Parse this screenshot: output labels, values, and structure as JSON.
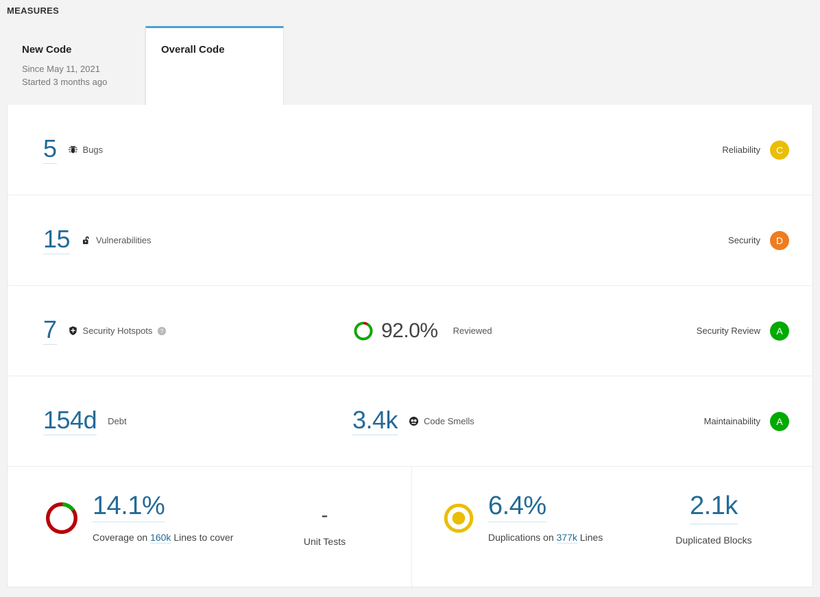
{
  "section": {
    "title": "MEASURES"
  },
  "tabs": [
    {
      "id": "new-code",
      "label": "New Code",
      "sub1": "Since May 11, 2021",
      "sub2": "Started 3 months ago",
      "active": false
    },
    {
      "id": "overall-code",
      "label": "Overall Code",
      "sub1": "",
      "sub2": "",
      "active": true
    }
  ],
  "rows": {
    "bugs": {
      "value": "5",
      "label": "Bugs",
      "icon": "bug-icon",
      "rating_name": "Reliability",
      "rating_letter": "C",
      "rating_color": "#eabe06"
    },
    "vulnerabilities": {
      "value": "15",
      "label": "Vulnerabilities",
      "icon": "open-padlock-icon",
      "rating_name": "Security",
      "rating_letter": "D",
      "rating_color": "#ed7d20"
    },
    "hotspots": {
      "value": "7",
      "label": "Security Hotspots",
      "icon": "shield-icon",
      "help_icon": "help-icon",
      "reviewed_percent": "92.0%",
      "reviewed_label": "Reviewed",
      "reviewed_value": 92.0,
      "donut_done_color": "#00aa00",
      "donut_remain_color": "#b60205",
      "rating_name": "Security Review",
      "rating_letter": "A",
      "rating_color": "#00aa00"
    },
    "maintainability": {
      "debt_value": "154d",
      "debt_label": "Debt",
      "smells_value": "3.4k",
      "smells_label": "Code Smells",
      "smells_icon": "code-smell-icon",
      "rating_name": "Maintainability",
      "rating_letter": "A",
      "rating_color": "#00aa00"
    },
    "coverage": {
      "percent": "14.1%",
      "percent_value": 14.1,
      "prefix": "Coverage on",
      "lines_link": "160k",
      "suffix": "Lines to cover",
      "donut_done_color": "#00aa00",
      "donut_remain_color": "#b60205",
      "unit_tests_value": "-",
      "unit_tests_label": "Unit Tests"
    },
    "duplications": {
      "percent": "6.4%",
      "percent_value": 6.4,
      "prefix": "Duplications on",
      "lines_link": "377k",
      "suffix": "Lines",
      "icon": "duplications-ring-icon",
      "icon_color": "#eabe06",
      "blocks_value": "2.1k",
      "blocks_label": "Duplicated Blocks"
    }
  }
}
